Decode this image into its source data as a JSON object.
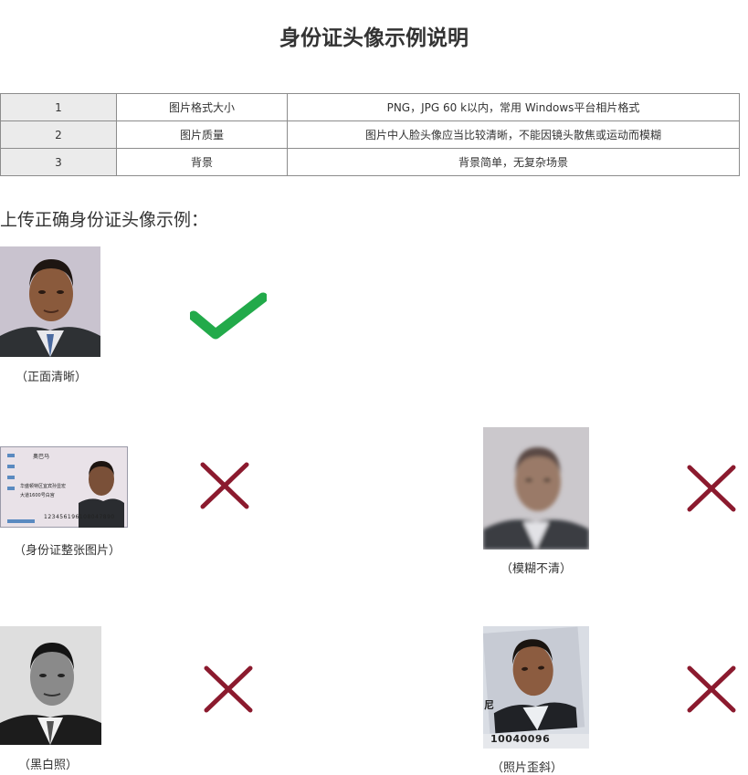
{
  "title": "身份证头像示例说明",
  "requirements": [
    {
      "no": "1",
      "name": "图片格式大小",
      "desc": "PNG，JPG  60 k以内，常用 Windows平台相片格式"
    },
    {
      "no": "2",
      "name": "图片质量",
      "desc": "图片中人脸头像应当比较清晰，不能因镜头散焦或运动而模糊"
    },
    {
      "no": "3",
      "name": "背景",
      "desc": "背景简单，无复杂场景"
    }
  ],
  "subtitle": "上传正确身份证头像示例：",
  "examples": {
    "correct": {
      "caption": "（正面清晰）",
      "mark": "check-icon"
    },
    "idcard": {
      "caption": "（身份证整张图片）",
      "mark": "cross-icon",
      "card_name": "奥巴马",
      "card_line": "华盛顿特区宜宾孙显宏",
      "card_line2": "大道1600号白宫",
      "card_number": "123456196108047890"
    },
    "blurry": {
      "caption": "（模糊不清）",
      "mark": "cross-icon"
    },
    "bw": {
      "caption": "（黑白照）",
      "mark": "cross-icon"
    },
    "tilted": {
      "caption": "（照片歪斜）",
      "mark": "cross-icon",
      "edge_text": "尼",
      "edge_number": "10040096"
    }
  },
  "colors": {
    "check": "#22aa4a",
    "cross": "#8b1a2e",
    "table_border": "#8c8c8c",
    "table_shade": "#ebebeb"
  }
}
